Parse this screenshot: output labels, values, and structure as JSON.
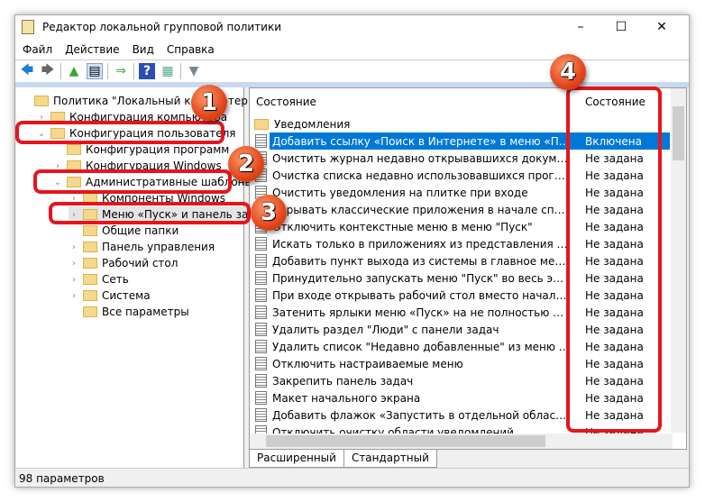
{
  "window": {
    "title": "Редактор локальной групповой политики",
    "minimize": "–",
    "maximize": "☐",
    "close": "✕"
  },
  "menu": [
    "Файл",
    "Действие",
    "Вид",
    "Справка"
  ],
  "toolbar": {
    "back": "🡄",
    "forward": "🡆",
    "up": "▲",
    "showhide": "▤",
    "export": "⇒",
    "help": "?",
    "view": "▦",
    "filter": "▼"
  },
  "tree": [
    {
      "label": "Политика \"Локальный компьютер\"",
      "exp": "",
      "level": 0
    },
    {
      "label": "Конфигурация компьютера",
      "exp": "›",
      "level": 1
    },
    {
      "label": "Конфигурация пользователя",
      "exp": "⌄",
      "level": 1
    },
    {
      "label": "Конфигурация программ",
      "exp": "",
      "level": 2
    },
    {
      "label": "Конфигурация Windows",
      "exp": "›",
      "level": 2
    },
    {
      "label": "Административные шаблоны",
      "exp": "⌄",
      "level": 2
    },
    {
      "label": "Компоненты Windows",
      "exp": "›",
      "level": 3
    },
    {
      "label": "Меню «Пуск» и панель задач",
      "exp": "›",
      "level": 3
    },
    {
      "label": "Общие папки",
      "exp": "",
      "level": 3
    },
    {
      "label": "Панель управления",
      "exp": "›",
      "level": 3
    },
    {
      "label": "Рабочий стол",
      "exp": "›",
      "level": 3
    },
    {
      "label": "Сеть",
      "exp": "›",
      "level": 3
    },
    {
      "label": "Система",
      "exp": "›",
      "level": 3
    },
    {
      "label": "Все параметры",
      "exp": "",
      "level": 3
    }
  ],
  "list": {
    "col_name": "Состояние",
    "col_state": "Состояние",
    "folder": "Уведомления",
    "rows": [
      {
        "name": "Добавить ссылку «Поиск в Интернете» в меню «Пуск»",
        "state": "Включена"
      },
      {
        "name": "Очистить журнал недавно открывавшихся документов п...",
        "state": "Не задана"
      },
      {
        "name": "Очистка списка недавно использовавшихся программ д...",
        "state": "Не задана"
      },
      {
        "name": "Очистить уведомления на плитке при входе",
        "state": "Не задана"
      },
      {
        "name": "Скрывать классические приложения в начале списка в ...",
        "state": "Не задана"
      },
      {
        "name": "Отключить контекстные меню в меню \"Пуск\"",
        "state": "Не задана"
      },
      {
        "name": "Искать только в приложениях из представления «Прило...",
        "state": "Не задана"
      },
      {
        "name": "Добавить пункт выхода из системы в главное меню",
        "state": "Не задана"
      },
      {
        "name": "Принудительно запускать меню \"Пуск\" во весь экран ил...",
        "state": "Не задана"
      },
      {
        "name": "При входе открывать рабочий стол вместо начального э...",
        "state": "Не задана"
      },
      {
        "name": "Затенить ярлыки меню «Пуск» на не полностью установ...",
        "state": "Не задана"
      },
      {
        "name": "Удалить раздел \"Люди\" с панели задач",
        "state": "Не задана"
      },
      {
        "name": "Удалить список \"Недавно добавленные\" из меню \"Пуск\"",
        "state": "Не задана"
      },
      {
        "name": "Отключить настраиваемые меню",
        "state": "Не задана"
      },
      {
        "name": "Закрепить панель задач",
        "state": "Не задана"
      },
      {
        "name": "Макет начального экрана",
        "state": "Не задана"
      },
      {
        "name": "Добавить флажок «Запустить в отдельной области памят...",
        "state": "Не задана"
      },
      {
        "name": "Отключить очистку области уведомлений",
        "state": "Не задана"
      }
    ]
  },
  "tabs": [
    "Расширенный",
    "Стандартный"
  ],
  "status": "98 параметров",
  "annotations": [
    "1",
    "2",
    "3",
    "4"
  ],
  "colors": {
    "selection": "#0078d7",
    "highlight": "#e8141c",
    "badge": "#e2461a"
  }
}
